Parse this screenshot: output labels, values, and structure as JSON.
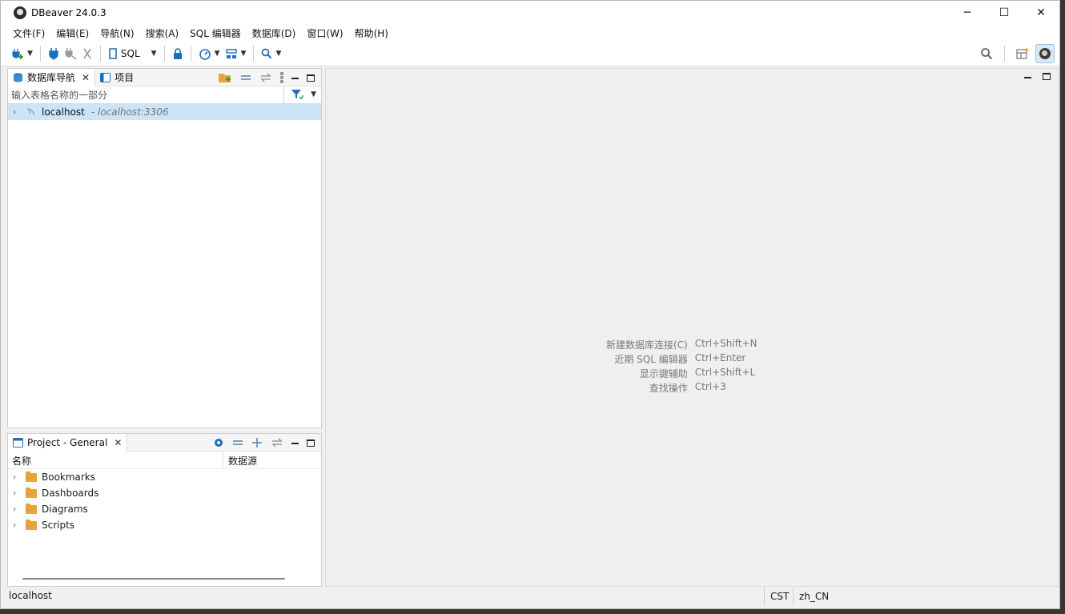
{
  "window": {
    "title": "DBeaver 24.0.3",
    "controls": [
      "─",
      "☐",
      "✕"
    ]
  },
  "menu": [
    "文件(F)",
    "编辑(E)",
    "导航(N)",
    "搜索(A)",
    "SQL 编辑器",
    "数据库(D)",
    "窗口(W)",
    "帮助(H)"
  ],
  "toolbar": {
    "sql_label": "SQL"
  },
  "navigator": {
    "tab_label": "数据库导航",
    "projects_tab_label": "项目",
    "filter_placeholder": "输入表格名称的一部分",
    "connections": [
      {
        "host": "localhost",
        "detail": "- localhost:3306"
      }
    ]
  },
  "project": {
    "tab_label": "Project - General",
    "columns": {
      "name": "名称",
      "datasource": "数据源"
    },
    "items": [
      "Bookmarks",
      "Dashboards",
      "Diagrams",
      "Scripts"
    ]
  },
  "editor_hints": [
    {
      "label": "新建数据库连接(C)",
      "shortcut": "Ctrl+Shift+N"
    },
    {
      "label": "近期 SQL 编辑器",
      "shortcut": "Ctrl+Enter"
    },
    {
      "label": "显示键辅助",
      "shortcut": "Ctrl+Shift+L"
    },
    {
      "label": "查找操作",
      "shortcut": "Ctrl+3"
    }
  ],
  "status": {
    "host": "localhost",
    "timezone": "CST",
    "locale": "zh_CN"
  },
  "colors": {
    "accent": "#1d6fb8",
    "folder": "#e8a33a",
    "selection": "#cce4f7"
  }
}
